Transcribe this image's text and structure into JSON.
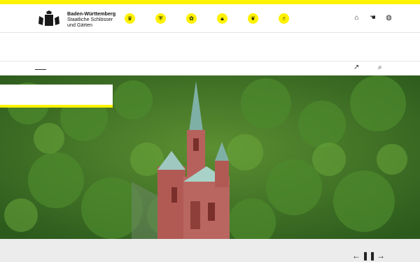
{
  "brand": {
    "line1": "Baden-Württemberg",
    "line2": "Staatliche Schlösser",
    "line3": "und Gärten"
  },
  "nav_icons": [
    {
      "name": "crown-icon"
    },
    {
      "name": "shield-icon"
    },
    {
      "name": "garden-icon"
    },
    {
      "name": "lock-icon"
    },
    {
      "name": "leaf-icon"
    },
    {
      "name": "chair-icon"
    }
  ],
  "right_icons": [
    {
      "name": "present-icon"
    },
    {
      "name": "hand-icon"
    },
    {
      "name": "globe-icon"
    }
  ],
  "colors": {
    "accent": "#fff200"
  },
  "controls": {
    "prev": "←",
    "pause": "❚❚",
    "next": "→"
  }
}
